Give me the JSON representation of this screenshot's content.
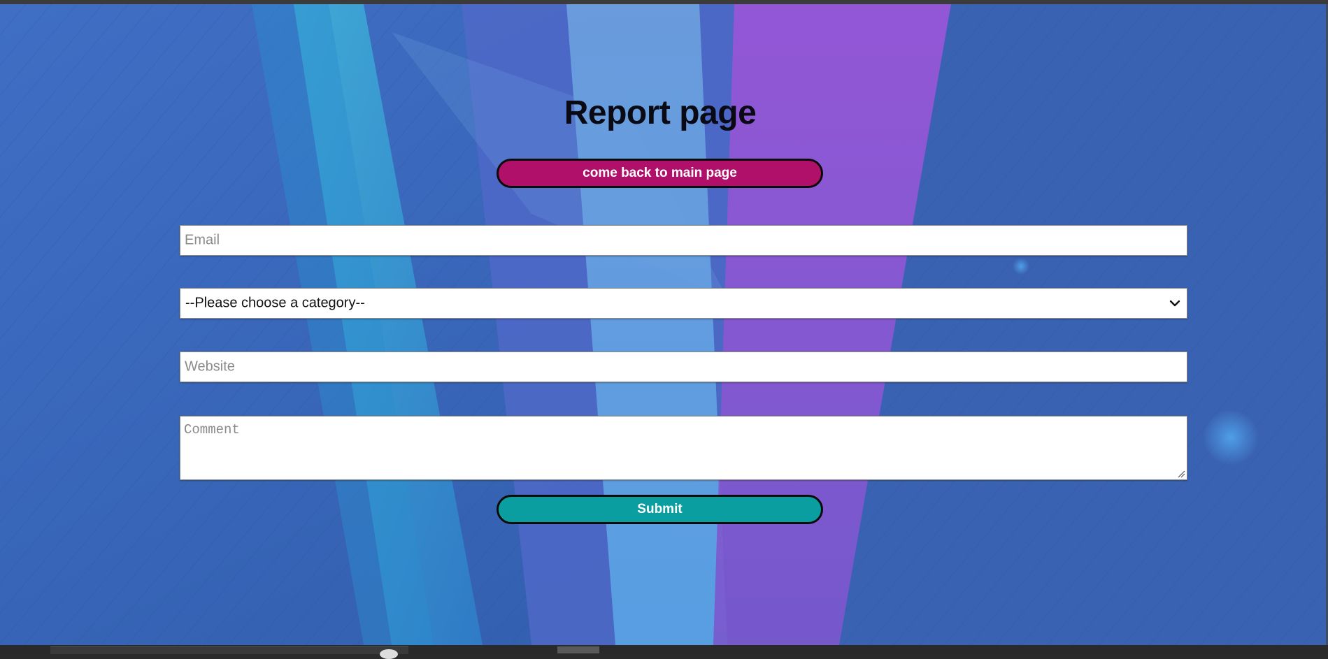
{
  "page": {
    "title": "Report page",
    "back_button_label": "come back to main page"
  },
  "form": {
    "email": {
      "placeholder": "Email",
      "value": ""
    },
    "category": {
      "selected": "--Please choose a category--"
    },
    "website": {
      "placeholder": "Website",
      "value": ""
    },
    "comment": {
      "placeholder": "Comment",
      "value": ""
    },
    "submit_label": "Submit"
  },
  "icons": {
    "select_arrow": "chevron-down-icon",
    "resize_handle": "resize-grip-icon"
  },
  "colors": {
    "background": "#3a63b4",
    "back_button": "#b0106a",
    "submit_button": "#0a9ea0",
    "title_text": "#0a0a14"
  }
}
